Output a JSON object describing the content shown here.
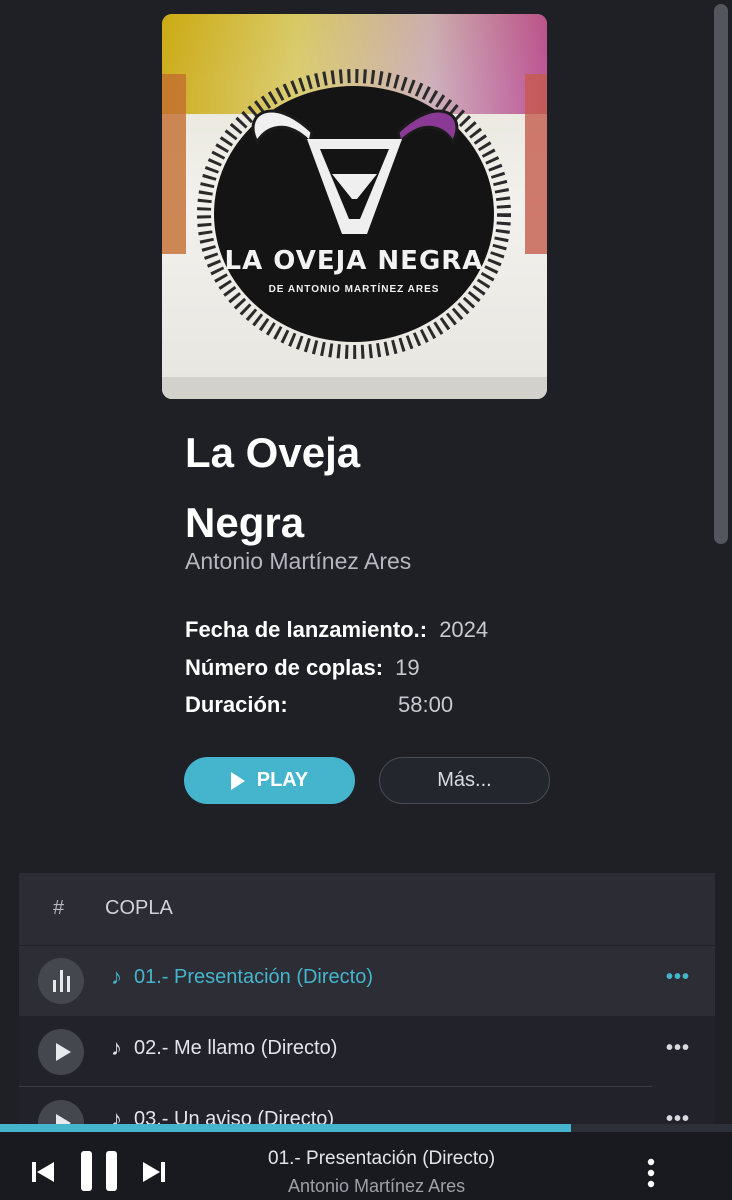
{
  "album": {
    "title_line1": "La Oveja",
    "title_line2": "Negra",
    "artist": "Antonio Martínez Ares",
    "cover_text": {
      "logo": "LA OVEJA NEGRA",
      "subtitle": "DE ANTONIO MARTÍNEZ ARES"
    }
  },
  "meta": {
    "release_label": "Fecha de lanzamiento.:",
    "release_value": "2024",
    "count_label": "Número de coplas:",
    "count_value": "19",
    "duration_label": "Duración:",
    "duration_value": "58:00"
  },
  "actions": {
    "play_label": "PLAY",
    "more_label": "Más..."
  },
  "table": {
    "col_number": "#",
    "col_title": "COPLA",
    "tracks": [
      {
        "title": "01.- Presentación (Directo)",
        "state": "playing"
      },
      {
        "title": "02.- Me llamo (Directo)",
        "state": "idle"
      },
      {
        "title": "03.- Un aviso (Directo)",
        "state": "idle"
      }
    ],
    "note_glyph": "♪",
    "more_glyph": "•••"
  },
  "player": {
    "now_playing_title": "01.- Presentación (Directo)",
    "now_playing_artist": "Antonio Martínez Ares",
    "progress_fraction": 0.78
  },
  "colors": {
    "accent": "#45b5cd",
    "background": "#1f2026"
  },
  "icons": {
    "previous": "skip-previous-icon",
    "pause": "pause-icon",
    "next": "skip-next-icon",
    "menu": "more-vertical-icon",
    "equalizer": "equalizer-icon",
    "play": "play-icon"
  }
}
